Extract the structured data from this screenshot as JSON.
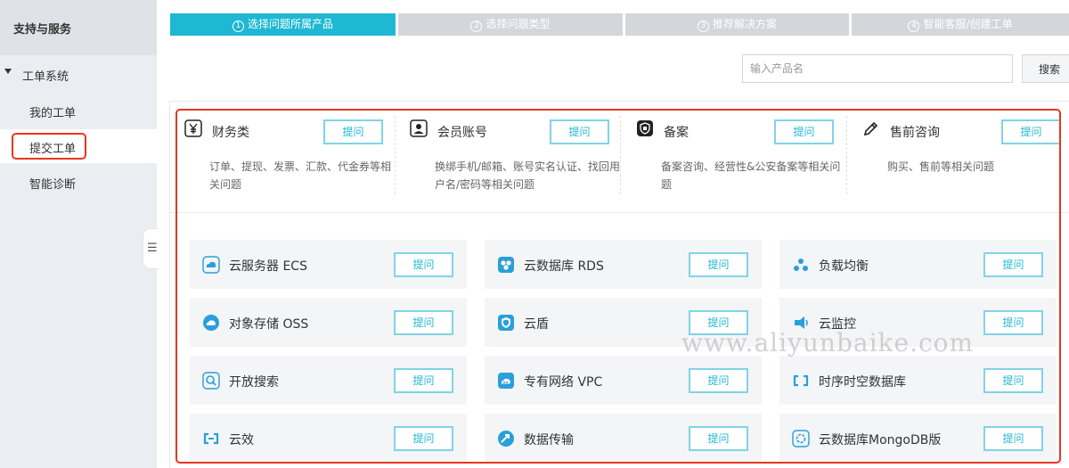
{
  "sidebar": {
    "title": "支持与服务",
    "group_label": "工单系统",
    "items": [
      {
        "label": "我的工单"
      },
      {
        "label": "提交工单"
      },
      {
        "label": "智能诊断"
      }
    ],
    "collapse_glyph": "☰"
  },
  "steps": [
    {
      "num": "1",
      "label": "选择问题所属产品"
    },
    {
      "num": "2",
      "label": "选择问题类型"
    },
    {
      "num": "3",
      "label": "推荐解决方案"
    },
    {
      "num": "4",
      "label": "智能客服/创建工单"
    }
  ],
  "search": {
    "placeholder": "输入产品名",
    "button_label": "搜索"
  },
  "ask_label": "提问",
  "categories": [
    {
      "icon": "yen-icon",
      "title": "财务类",
      "desc": "订单、提现、发票、汇款、代金券等相关问题"
    },
    {
      "icon": "user-icon",
      "title": "会员账号",
      "desc": "换绑手机/邮箱、账号实名认证、找回用户名/密码等相关问题"
    },
    {
      "icon": "shield-icon",
      "title": "备案",
      "desc": "备案咨询、经营性&公安备案等相关问题"
    },
    {
      "icon": "pencil-icon",
      "title": "售前咨询",
      "desc": "购买、售前等相关问题"
    }
  ],
  "products": [
    {
      "icon": "cloud-server-icon",
      "name": "云服务器 ECS"
    },
    {
      "icon": "cloud-database-icon",
      "name": "云数据库 RDS"
    },
    {
      "icon": "load-balancer-icon",
      "name": "负载均衡"
    },
    {
      "icon": "object-storage-icon",
      "name": "对象存储 OSS"
    },
    {
      "icon": "cloud-shield-icon",
      "name": "云盾"
    },
    {
      "icon": "cloud-monitor-icon",
      "name": "云监控"
    },
    {
      "icon": "open-search-icon",
      "name": "开放搜索"
    },
    {
      "icon": "vpc-icon",
      "name": "专有网络 VPC"
    },
    {
      "icon": "time-series-db-icon",
      "name": "时序时空数据库"
    },
    {
      "icon": "cloud-effect-icon",
      "name": "云效"
    },
    {
      "icon": "data-transfer-icon",
      "name": "数据传输"
    },
    {
      "icon": "mongodb-icon",
      "name": "云数据库MongoDB版"
    }
  ],
  "watermark": "www.aliyunbaike.com",
  "colors": {
    "accent": "#1fb8d3",
    "highlight_frame": "#e8351f",
    "step_inactive": "#d3d7dc"
  }
}
